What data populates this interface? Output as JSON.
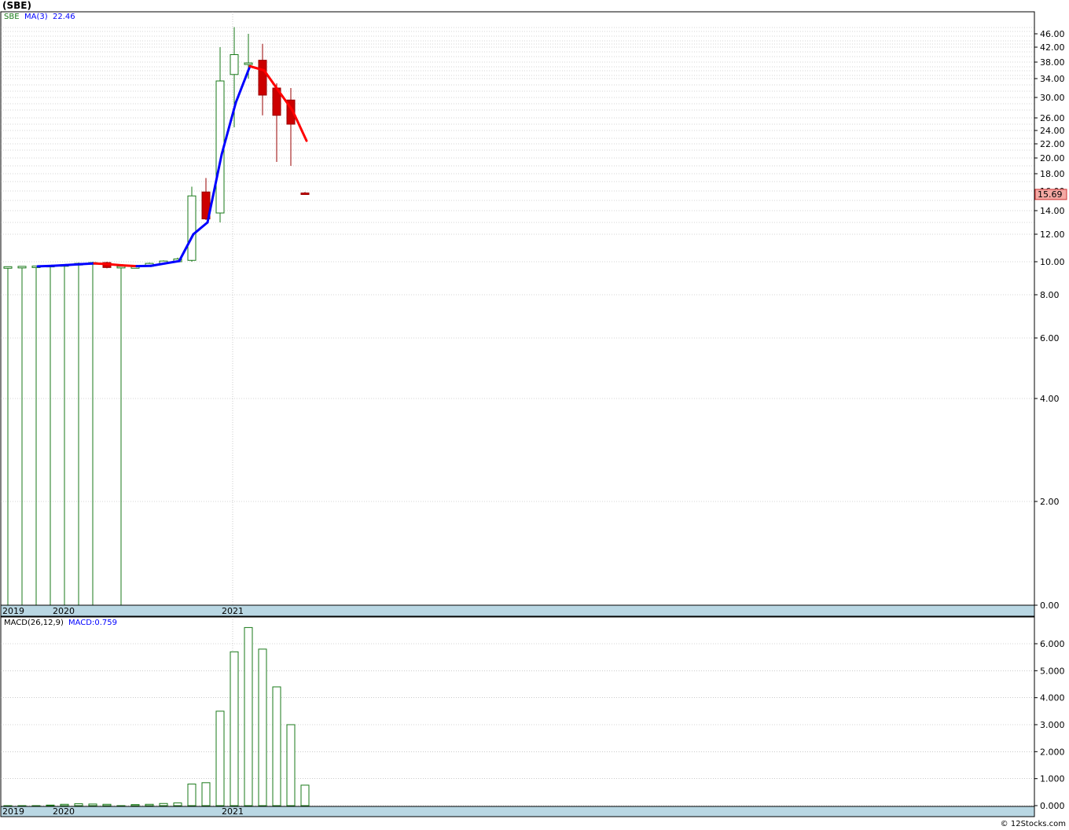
{
  "title": "(SBE)",
  "credit": "© 12Stocks.com",
  "colors": {
    "up": "#1a7a1a",
    "down": "#cc0000",
    "ma_up": "#0000ff",
    "ma_down": "#ff0000",
    "grid": "#aaaaaa",
    "axisband": "#b9d7e3",
    "lastbox": "#f4a9a4"
  },
  "chart_data": [
    {
      "type": "candlestick",
      "legend": {
        "symbol": "SBE",
        "ma_label": "MA(3)",
        "ma_value": "22.46"
      },
      "scale": "log",
      "y_ticks": [
        "46.00",
        "42.00",
        "38.00",
        "34.00",
        "30.00",
        "26.00",
        "24.00",
        "22.00",
        "20.00",
        "18.00",
        "16.00",
        "14.00",
        "12.00",
        "10.00",
        "8.00",
        "6.00",
        "4.00",
        "2.00",
        "0.00"
      ],
      "x_labels": [
        "2019",
        "2020",
        "2021"
      ],
      "last_price": "15.69",
      "candles": [
        {
          "o": 9.65,
          "h": 9.7,
          "l": 0,
          "c": 9.7
        },
        {
          "o": 9.7,
          "h": 9.72,
          "l": 0,
          "c": 9.72
        },
        {
          "o": 9.7,
          "h": 9.75,
          "l": 0,
          "c": 9.74
        },
        {
          "o": 9.72,
          "h": 9.8,
          "l": 0,
          "c": 9.78
        },
        {
          "o": 9.75,
          "h": 9.85,
          "l": 0,
          "c": 9.82
        },
        {
          "o": 9.8,
          "h": 9.95,
          "l": 0,
          "c": 9.9
        },
        {
          "o": 9.85,
          "h": 10.0,
          "l": 0,
          "c": 9.95
        },
        {
          "o": 9.95,
          "h": 10.0,
          "l": 9.6,
          "c": 9.65
        },
        {
          "o": 9.7,
          "h": 9.75,
          "l": 0,
          "c": 9.72
        },
        {
          "o": 9.7,
          "h": 9.72,
          "l": 9.68,
          "c": 9.7
        },
        {
          "o": 9.72,
          "h": 9.95,
          "l": 9.7,
          "c": 9.9
        },
        {
          "o": 9.9,
          "h": 10.1,
          "l": 9.85,
          "c": 10.05
        },
        {
          "o": 10.0,
          "h": 10.3,
          "l": 9.95,
          "c": 10.2
        },
        {
          "o": 10.1,
          "h": 16.5,
          "l": 10.0,
          "c": 15.5
        },
        {
          "o": 15.9,
          "h": 17.5,
          "l": 13.2,
          "c": 13.3
        },
        {
          "o": 13.8,
          "h": 42.0,
          "l": 13.0,
          "c": 33.5
        },
        {
          "o": 35.0,
          "h": 48.0,
          "l": 24.5,
          "c": 40.0
        },
        {
          "o": 37.5,
          "h": 46.0,
          "l": 34.0,
          "c": 37.8
        },
        {
          "o": 38.5,
          "h": 43.0,
          "l": 26.5,
          "c": 30.5
        },
        {
          "o": 32.0,
          "h": 33.0,
          "l": 19.5,
          "c": 26.5
        },
        {
          "o": 29.5,
          "h": 32.0,
          "l": 19.0,
          "c": 25.0
        },
        {
          "o": 15.8,
          "h": 15.9,
          "l": 15.6,
          "c": 15.69
        }
      ],
      "ma": [
        {
          "i": 2,
          "v": 9.72
        },
        {
          "i": 3,
          "v": 9.75
        },
        {
          "i": 4,
          "v": 9.8
        },
        {
          "i": 5,
          "v": 9.85
        },
        {
          "i": 6,
          "v": 9.9
        },
        {
          "i": 7,
          "v": 9.85
        },
        {
          "i": 8,
          "v": 9.78
        },
        {
          "i": 9,
          "v": 9.73
        },
        {
          "i": 10,
          "v": 9.75
        },
        {
          "i": 11,
          "v": 9.9
        },
        {
          "i": 12,
          "v": 10.05
        },
        {
          "i": 13,
          "v": 12.0
        },
        {
          "i": 14,
          "v": 13.0
        },
        {
          "i": 15,
          "v": 20.5
        },
        {
          "i": 16,
          "v": 29.0
        },
        {
          "i": 17,
          "v": 37.0
        },
        {
          "i": 18,
          "v": 36.0
        },
        {
          "i": 19,
          "v": 31.5
        },
        {
          "i": 20,
          "v": 27.5
        },
        {
          "i": 21,
          "v": 22.46
        }
      ]
    },
    {
      "type": "bar",
      "legend": {
        "label": "MACD(26,12,9)",
        "value_label": "MACD:0.759"
      },
      "y_ticks": [
        "6.000",
        "5.000",
        "4.000",
        "3.000",
        "2.000",
        "1.000",
        "0.000"
      ],
      "ylim": [
        0,
        6.8
      ],
      "x_labels": [
        "2019",
        "2020",
        "2021"
      ],
      "values": [
        0,
        0,
        0,
        0.02,
        0.05,
        0.07,
        0.06,
        0.05,
        0,
        0.04,
        0.05,
        0.08,
        0.1,
        0.8,
        0.85,
        3.5,
        5.7,
        6.6,
        5.8,
        4.4,
        3.0,
        0.759
      ]
    }
  ]
}
